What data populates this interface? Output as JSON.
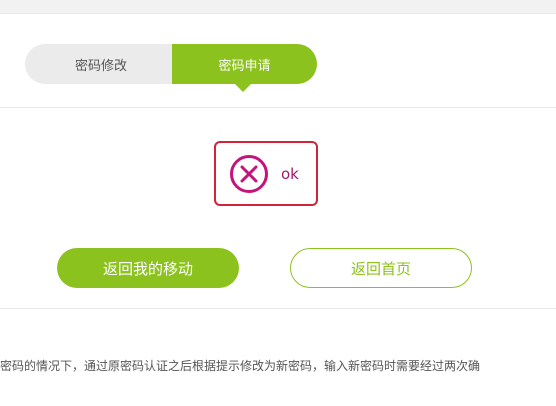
{
  "tabs": {
    "modify_label": "密码修改",
    "apply_label": "密码申请"
  },
  "message": {
    "icon": "error-x-icon",
    "text": "ok",
    "color": "#a0186e",
    "border_color": "#d0243a"
  },
  "buttons": {
    "back_my_mobile": "返回我的移动",
    "back_home": "返回首页"
  },
  "description": "密码的情况下，通过原密码认证之后根据提示修改为新密码，输入新密码时需要经过两次确",
  "colors": {
    "accent": "#8cc21d",
    "tab_inactive_bg": "#ebebeb"
  }
}
